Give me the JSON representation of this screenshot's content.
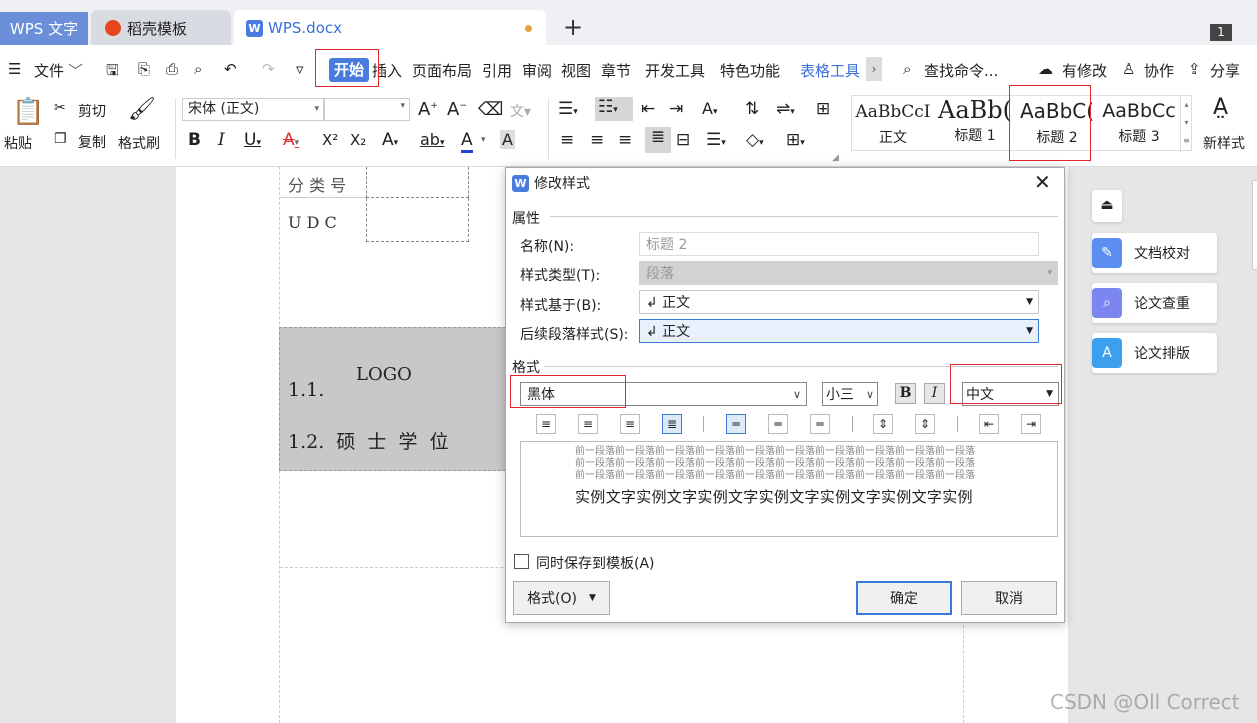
{
  "tabs": {
    "app": "WPS 文字",
    "daoke": "稻壳模板",
    "doc": "WPS.docx",
    "add": "+",
    "counter": "1"
  },
  "menu": {
    "hamburger": "☰",
    "file": "文件",
    "start": "开始",
    "insert": "插入",
    "layout": "页面布局",
    "reference": "引用",
    "review": "审阅",
    "view": "视图",
    "chapter": "章节",
    "dev": "开发工具",
    "special": "特色功能",
    "table_tools": "表格工具",
    "search": "查找命令...",
    "modified": "有修改",
    "collab": "协作",
    "share": "分享"
  },
  "toolbar": {
    "paste": "粘贴",
    "cut": "剪切",
    "copy": "复制",
    "format_painter": "格式刷",
    "font_name": "宋体 (正文)",
    "font_size": "",
    "styles": [
      {
        "preview": "AaBbCcI",
        "name": "正文"
      },
      {
        "preview": "AaBb(",
        "name": "标题 1"
      },
      {
        "preview": "AaBbC(",
        "name": "标题 2"
      },
      {
        "preview": "AaBbCc",
        "name": "标题 3"
      }
    ],
    "new_style": "新样式"
  },
  "document": {
    "cls": "分 类 号",
    "udc": "U D C",
    "logo": "LOGO",
    "h1": "1.1.",
    "h2": "1.2.  硕  士  学  位"
  },
  "side_panel": {
    "items": [
      "文档校对",
      "论文查重",
      "论文排版"
    ]
  },
  "dialog": {
    "title": "修改样式",
    "section_props": "属性",
    "name_label": "名称(N):",
    "name_value": "标题 2",
    "type_label": "样式类型(T):",
    "type_value": "段落",
    "based_label": "样式基于(B):",
    "based_value": "↲ 正文",
    "next_label": "后续段落样式(S):",
    "next_value": "↲ 正文",
    "section_format": "格式",
    "font": "黑体",
    "size": "小三",
    "bold": "B",
    "italic": "I",
    "lang": "中文",
    "preview_prev": "前一段落前一段落前一段落前一段落前一段落前一段落前一段落前一段落前一段落前一段落",
    "preview_sample": "实例文字实例文字实例文字实例文字实例文字实例文字实例",
    "save_template": "同时保存到模板(A)",
    "format_btn": "格式(O)",
    "ok": "确定",
    "cancel": "取消"
  },
  "watermark": "CSDN @Oll Correct"
}
